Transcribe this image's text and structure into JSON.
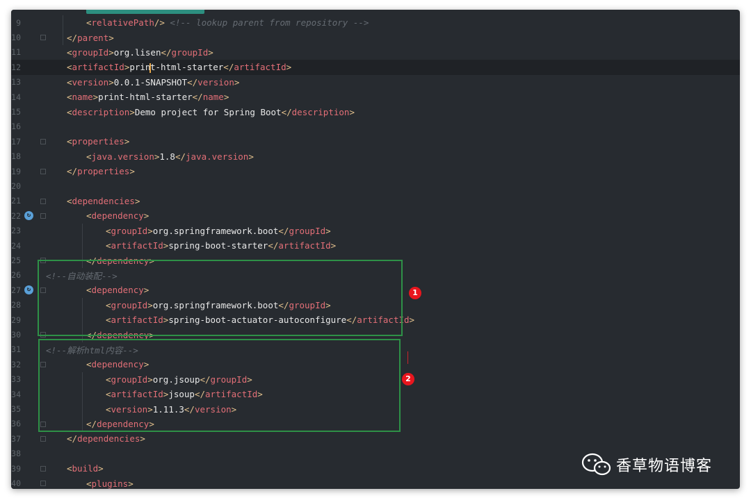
{
  "editor": {
    "lines": [
      {
        "n": "9",
        "parts": [
          [
            "br",
            "<"
          ],
          [
            "tg",
            "relativePath"
          ],
          [
            "br",
            "/> "
          ],
          [
            "cm",
            "<!-- lookup parent from repository -->"
          ]
        ]
      },
      {
        "n": "10",
        "parts": [
          [
            "br",
            "</"
          ],
          [
            "tg",
            "parent"
          ],
          [
            "br",
            ">"
          ]
        ]
      },
      {
        "n": "11",
        "parts": [
          [
            "br",
            "<"
          ],
          [
            "tg",
            "groupId"
          ],
          [
            "br",
            ">"
          ],
          [
            "tx",
            "org.lisen"
          ],
          [
            "br",
            "</"
          ],
          [
            "tg",
            "groupId"
          ],
          [
            "br",
            ">"
          ]
        ]
      },
      {
        "n": "12",
        "parts": [
          [
            "br",
            "<"
          ],
          [
            "tg",
            "artifactId"
          ],
          [
            "br",
            ">"
          ],
          [
            "tx",
            "print-html-starter"
          ],
          [
            "br",
            "</"
          ],
          [
            "tg",
            "artifactId"
          ],
          [
            "br",
            ">"
          ]
        ]
      },
      {
        "n": "13",
        "parts": [
          [
            "br",
            "<"
          ],
          [
            "tg",
            "version"
          ],
          [
            "br",
            ">"
          ],
          [
            "tx",
            "0.0.1-SNAPSHOT"
          ],
          [
            "br",
            "</"
          ],
          [
            "tg",
            "version"
          ],
          [
            "br",
            ">"
          ]
        ]
      },
      {
        "n": "14",
        "parts": [
          [
            "br",
            "<"
          ],
          [
            "tg",
            "name"
          ],
          [
            "br",
            ">"
          ],
          [
            "tx",
            "print-html-starter"
          ],
          [
            "br",
            "</"
          ],
          [
            "tg",
            "name"
          ],
          [
            "br",
            ">"
          ]
        ]
      },
      {
        "n": "15",
        "parts": [
          [
            "br",
            "<"
          ],
          [
            "tg",
            "description"
          ],
          [
            "br",
            ">"
          ],
          [
            "tx",
            "Demo project for Spring Boot"
          ],
          [
            "br",
            "</"
          ],
          [
            "tg",
            "description"
          ],
          [
            "br",
            ">"
          ]
        ]
      },
      {
        "n": "16",
        "parts": []
      },
      {
        "n": "17",
        "parts": [
          [
            "br",
            "<"
          ],
          [
            "tg",
            "properties"
          ],
          [
            "br",
            ">"
          ]
        ]
      },
      {
        "n": "18",
        "parts": [
          [
            "br",
            "<"
          ],
          [
            "tg",
            "java.version"
          ],
          [
            "br",
            ">"
          ],
          [
            "tx",
            "1.8"
          ],
          [
            "br",
            "</"
          ],
          [
            "tg",
            "java.version"
          ],
          [
            "br",
            ">"
          ]
        ]
      },
      {
        "n": "19",
        "parts": [
          [
            "br",
            "</"
          ],
          [
            "tg",
            "properties"
          ],
          [
            "br",
            ">"
          ]
        ]
      },
      {
        "n": "20",
        "parts": []
      },
      {
        "n": "21",
        "parts": [
          [
            "br",
            "<"
          ],
          [
            "tg",
            "dependencies"
          ],
          [
            "br",
            ">"
          ]
        ]
      },
      {
        "n": "22",
        "parts": [
          [
            "br",
            "<"
          ],
          [
            "tg",
            "dependency"
          ],
          [
            "br",
            ">"
          ]
        ]
      },
      {
        "n": "23",
        "parts": [
          [
            "br",
            "<"
          ],
          [
            "tg",
            "groupId"
          ],
          [
            "br",
            ">"
          ],
          [
            "tx",
            "org.springframework.boot"
          ],
          [
            "br",
            "</"
          ],
          [
            "tg",
            "groupId"
          ],
          [
            "br",
            ">"
          ]
        ]
      },
      {
        "n": "24",
        "parts": [
          [
            "br",
            "<"
          ],
          [
            "tg",
            "artifactId"
          ],
          [
            "br",
            ">"
          ],
          [
            "tx",
            "spring-boot-starter"
          ],
          [
            "br",
            "</"
          ],
          [
            "tg",
            "artifactId"
          ],
          [
            "br",
            ">"
          ]
        ]
      },
      {
        "n": "25",
        "parts": [
          [
            "br",
            "</"
          ],
          [
            "tg",
            "dependency"
          ],
          [
            "br",
            ">"
          ]
        ]
      },
      {
        "n": "26",
        "parts": [
          [
            "cm",
            "<!--自动装配-->"
          ]
        ]
      },
      {
        "n": "27",
        "parts": [
          [
            "br",
            "<"
          ],
          [
            "tg",
            "dependency"
          ],
          [
            "br",
            ">"
          ]
        ]
      },
      {
        "n": "28",
        "parts": [
          [
            "br",
            "<"
          ],
          [
            "tg",
            "groupId"
          ],
          [
            "br",
            ">"
          ],
          [
            "tx",
            "org.springframework.boot"
          ],
          [
            "br",
            "</"
          ],
          [
            "tg",
            "groupId"
          ],
          [
            "br",
            ">"
          ]
        ]
      },
      {
        "n": "29",
        "parts": [
          [
            "br",
            "<"
          ],
          [
            "tg",
            "artifactId"
          ],
          [
            "br",
            ">"
          ],
          [
            "tx",
            "spring-boot-actuator-autoconfigure"
          ],
          [
            "br",
            "</"
          ],
          [
            "tg",
            "artifactId"
          ],
          [
            "br",
            ">"
          ]
        ]
      },
      {
        "n": "30",
        "parts": [
          [
            "br",
            "</"
          ],
          [
            "tg",
            "dependency"
          ],
          [
            "br",
            ">"
          ]
        ]
      },
      {
        "n": "31",
        "parts": [
          [
            "cm",
            "<!--解析html内容-->"
          ]
        ]
      },
      {
        "n": "32",
        "parts": [
          [
            "br",
            "<"
          ],
          [
            "tg",
            "dependency"
          ],
          [
            "br",
            ">"
          ]
        ]
      },
      {
        "n": "33",
        "parts": [
          [
            "br",
            "<"
          ],
          [
            "tg",
            "groupId"
          ],
          [
            "br",
            ">"
          ],
          [
            "tx",
            "org.jsoup"
          ],
          [
            "br",
            "</"
          ],
          [
            "tg",
            "groupId"
          ],
          [
            "br",
            ">"
          ]
        ]
      },
      {
        "n": "34",
        "parts": [
          [
            "br",
            "<"
          ],
          [
            "tg",
            "artifactId"
          ],
          [
            "br",
            ">"
          ],
          [
            "tx",
            "jsoup"
          ],
          [
            "br",
            "</"
          ],
          [
            "tg",
            "artifactId"
          ],
          [
            "br",
            ">"
          ]
        ]
      },
      {
        "n": "35",
        "parts": [
          [
            "br",
            "<"
          ],
          [
            "tg",
            "version"
          ],
          [
            "br",
            ">"
          ],
          [
            "tx",
            "1.11.3"
          ],
          [
            "br",
            "</"
          ],
          [
            "tg",
            "version"
          ],
          [
            "br",
            ">"
          ]
        ]
      },
      {
        "n": "36",
        "parts": [
          [
            "br",
            "</"
          ],
          [
            "tg",
            "dependency"
          ],
          [
            "br",
            ">"
          ]
        ]
      },
      {
        "n": "37",
        "parts": [
          [
            "br",
            "</"
          ],
          [
            "tg",
            "dependencies"
          ],
          [
            "br",
            ">"
          ]
        ]
      },
      {
        "n": "38",
        "parts": []
      },
      {
        "n": "39",
        "parts": [
          [
            "br",
            "<"
          ],
          [
            "tg",
            "build"
          ],
          [
            "br",
            ">"
          ]
        ]
      },
      {
        "n": "40",
        "parts": [
          [
            "br",
            "<"
          ],
          [
            "tg",
            "plugins"
          ],
          [
            "br",
            ">"
          ]
        ]
      }
    ],
    "current_line": "12",
    "gutter_icon_lines": [
      "22",
      "27"
    ]
  },
  "annotations": {
    "marker1": "1",
    "marker2": "2"
  },
  "watermark": {
    "text": "香草物语博客",
    "icon": "wechat-icon"
  },
  "colors": {
    "background": "#272b30",
    "tag": "#e36f77",
    "bracket": "#e2c08d",
    "comment": "#656b72",
    "highlight_box": "#2e9147",
    "marker": "#e8161e"
  }
}
